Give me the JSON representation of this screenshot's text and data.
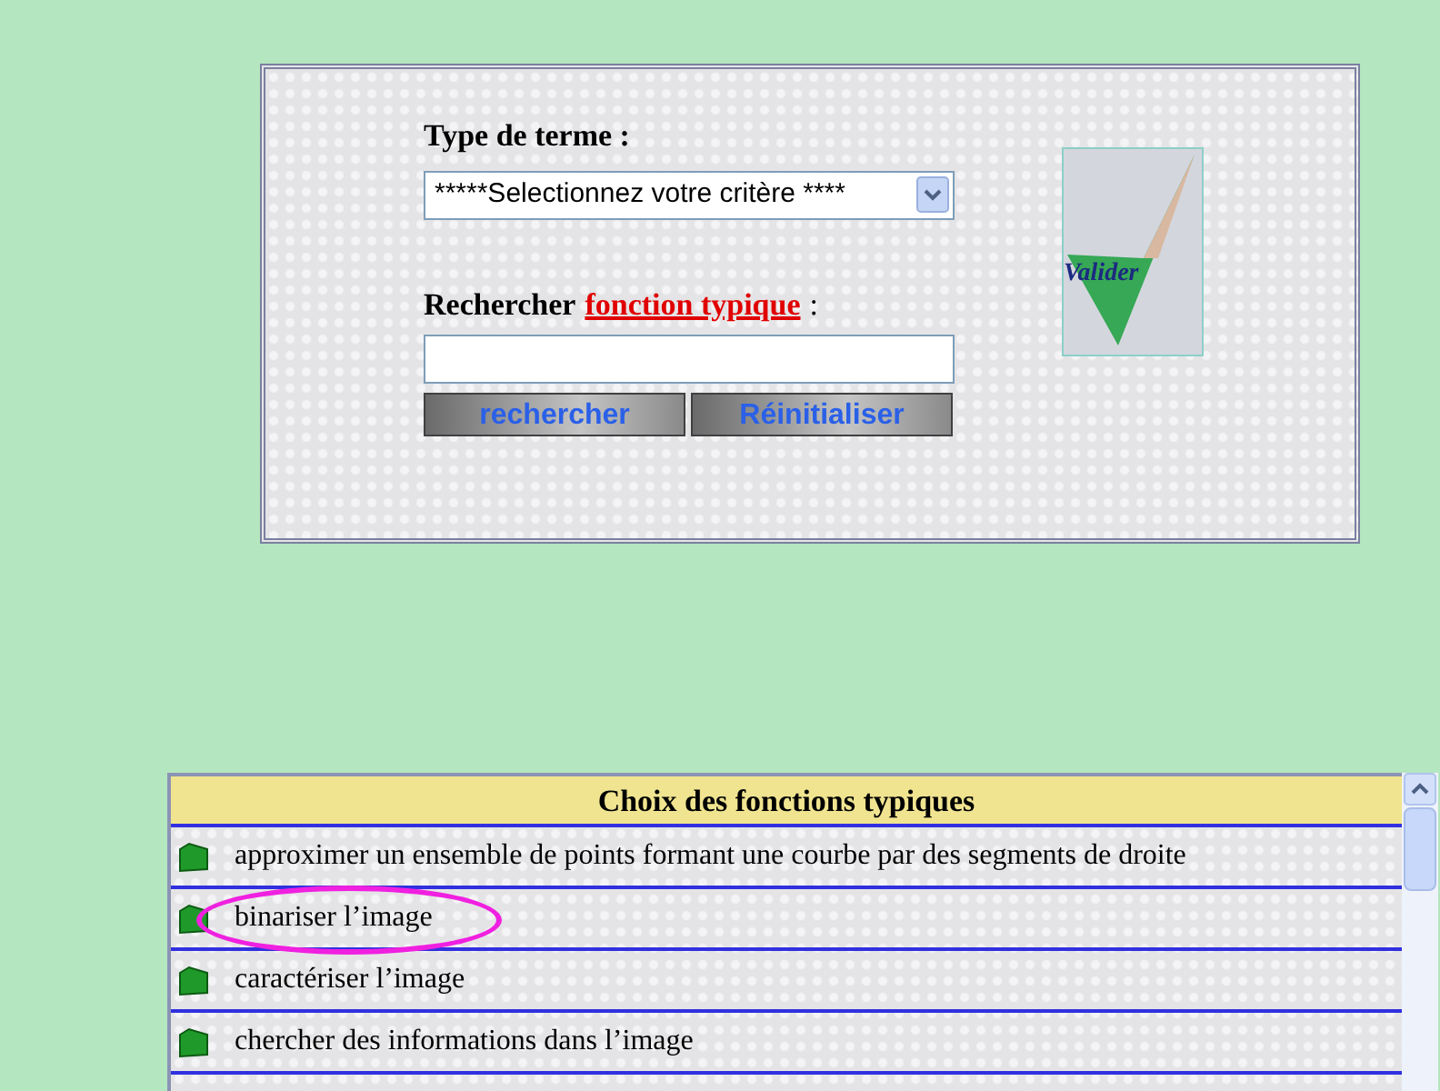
{
  "search_form": {
    "type_label": "Type de terme :",
    "type_select": {
      "value": "*****Selectionnez votre critère ****"
    },
    "search_label": "Rechercher",
    "search_link": "fonction typique",
    "search_colon": ":",
    "buttons": [
      "rechercher",
      "Réinitialiser"
    ],
    "validate_button": "Valider"
  },
  "list": {
    "title": "Choix des fonctions typiques",
    "items": [
      {
        "label": "approximer un ensemble de points formant une courbe par des segments de droite",
        "circled": false
      },
      {
        "label": "binariser l’image",
        "circled": true
      },
      {
        "label": "caractériser l’image",
        "circled": false
      },
      {
        "label": "chercher des informations dans l’image",
        "circled": false
      }
    ]
  }
}
